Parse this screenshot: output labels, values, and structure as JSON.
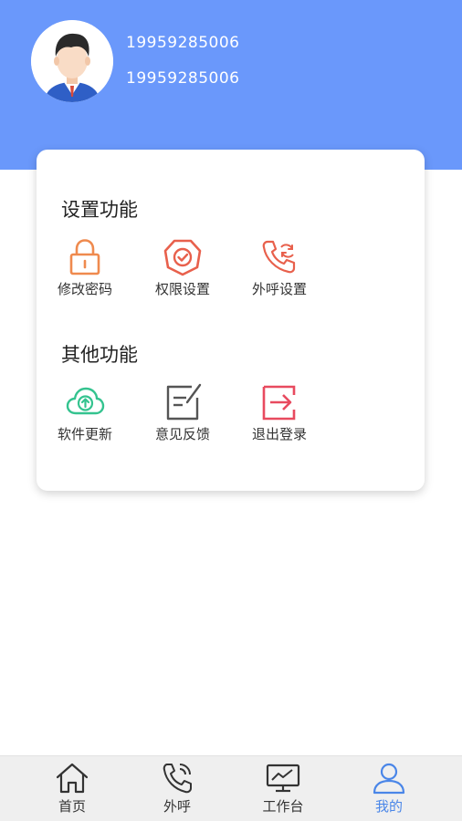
{
  "user": {
    "phone_primary": "19959285006",
    "phone_secondary": "19959285006"
  },
  "settings_section": {
    "title": "设置功能",
    "items": [
      {
        "label": "修改密码",
        "icon": "lock-icon"
      },
      {
        "label": "权限设置",
        "icon": "shield-check-icon"
      },
      {
        "label": "外呼设置",
        "icon": "phone-refresh-icon"
      }
    ]
  },
  "other_section": {
    "title": "其他功能",
    "items": [
      {
        "label": "软件更新",
        "icon": "cloud-upload-icon"
      },
      {
        "label": "意见反馈",
        "icon": "edit-note-icon"
      },
      {
        "label": "退出登录",
        "icon": "logout-icon"
      }
    ]
  },
  "tabbar": {
    "items": [
      {
        "label": "首页",
        "icon": "home-icon"
      },
      {
        "label": "外呼",
        "icon": "phone-icon"
      },
      {
        "label": "工作台",
        "icon": "monitor-icon"
      },
      {
        "label": "我的",
        "icon": "user-icon",
        "active": true
      }
    ]
  },
  "colors": {
    "header": "#6a98fb",
    "tab_active": "#4a86e8",
    "tab_inactive": "#333333",
    "lock": "#ef8a4e",
    "shield": "#e8604c",
    "phone_setting": "#e8604c",
    "cloud": "#34c38f",
    "feedback": "#555555",
    "logout": "#e84a5f"
  }
}
